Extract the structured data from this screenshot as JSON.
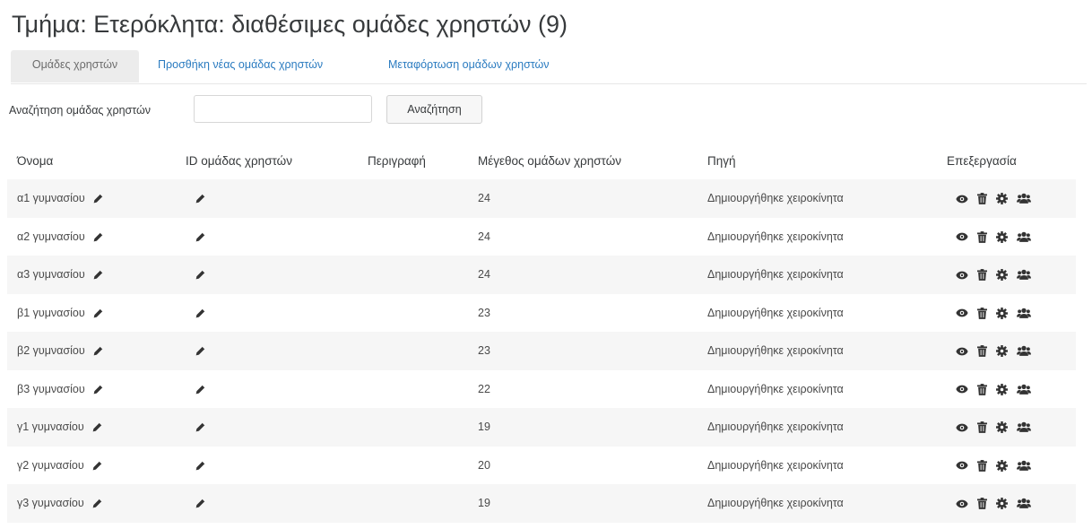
{
  "page": {
    "title": "Τμήμα: Ετερόκλητα: διαθέσιμες ομάδες χρηστών (9)"
  },
  "tabs": [
    {
      "label": "Ομάδες χρηστών",
      "active": true
    },
    {
      "label": "Προσθήκη νέας ομάδας χρηστών",
      "active": false
    },
    {
      "label": "Μεταφόρτωση ομάδων χρηστών",
      "active": false
    }
  ],
  "search": {
    "label": "Αναζήτηση ομάδας χρηστών",
    "value": "",
    "placeholder": "",
    "button_label": "Αναζήτηση"
  },
  "table": {
    "headers": {
      "name": "Όνομα",
      "idnumber": "ID ομάδας χρηστών",
      "description": "Περιγραφή",
      "size": "Μέγεθος ομάδων χρηστών",
      "source": "Πηγή",
      "edit": "Επεξεργασία"
    },
    "rows": [
      {
        "name": "α1 γυμνασίου",
        "size": "24",
        "source": "Δημιουργήθηκε χειροκίνητα"
      },
      {
        "name": "α2 γυμνασίου",
        "size": "24",
        "source": "Δημιουργήθηκε χειροκίνητα"
      },
      {
        "name": "α3 γυμνασίου",
        "size": "24",
        "source": "Δημιουργήθηκε χειροκίνητα"
      },
      {
        "name": "β1 γυμνασίου",
        "size": "23",
        "source": "Δημιουργήθηκε χειροκίνητα"
      },
      {
        "name": "β2 γυμνασίου",
        "size": "23",
        "source": "Δημιουργήθηκε χειροκίνητα"
      },
      {
        "name": "β3 γυμνασίου",
        "size": "22",
        "source": "Δημιουργήθηκε χειροκίνητα"
      },
      {
        "name": "γ1 γυμνασίου",
        "size": "19",
        "source": "Δημιουργήθηκε χειροκίνητα"
      },
      {
        "name": "γ2 γυμνασίου",
        "size": "20",
        "source": "Δημιουργήθηκε χειροκίνητα"
      },
      {
        "name": "γ3 γυμνασίου",
        "size": "19",
        "source": "Δημιουργήθηκε χειροκίνητα"
      }
    ],
    "row_icons": {
      "inline_edit": "pencil-icon",
      "actions": [
        "eye-icon",
        "trash-icon",
        "gear-icon",
        "users-icon"
      ]
    }
  },
  "colors": {
    "link": "#2a7bc0",
    "text": "#373a3c",
    "icon": "#333333",
    "stripe": "#f6f6f6",
    "active_tab_bg": "#ececec"
  }
}
